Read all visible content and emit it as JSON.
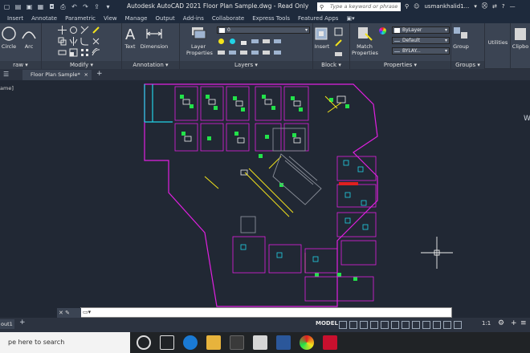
{
  "window": {
    "title": "Autodesk AutoCAD 2021    Floor Plan Sample.dwg - Read Only",
    "search_placeholder": "Type a keyword or phrase",
    "user": "usmankhalid1..."
  },
  "ribbon_tabs": [
    "Insert",
    "Annotate",
    "Parametric",
    "View",
    "Manage",
    "Output",
    "Add-ins",
    "Collaborate",
    "Express Tools",
    "Featured Apps"
  ],
  "ribbon": {
    "tools": {
      "circle": "Circle",
      "arc": "Arc",
      "text": "Text",
      "dimension": "Dimension",
      "layer_properties": "Layer Properties",
      "insert": "Insert",
      "match_properties": "Match Properties",
      "group": "Group",
      "utilities": "Utilities",
      "clipboard": "Clipbo"
    },
    "panels": {
      "draw": "raw",
      "modify": "Modify",
      "annotation": "Annotation",
      "layers": "Layers",
      "block": "Block",
      "properties": "Properties",
      "groups": "Groups"
    },
    "layer_value": "0",
    "prop_bylayer": "ByLayer",
    "prop_default": "Default",
    "prop_bylay2": "BYLAY..."
  },
  "document": {
    "tab_label": "Floor Plan Sample*",
    "view_label": "ame]"
  },
  "layout": {
    "tab_label": "out1",
    "model": "MODEL",
    "scale": "1:1"
  },
  "taskbar": {
    "search": "pe here to search"
  },
  "colors": {
    "cyan": "#22d3e6",
    "magenta": "#e020e0",
    "green": "#22e24a",
    "yellow": "#f2e21c",
    "white": "#f0f0f0",
    "gray": "#8a8f99"
  }
}
